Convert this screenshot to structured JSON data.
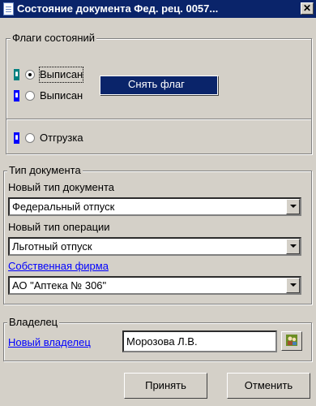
{
  "window": {
    "title": "Состояние документа Фед. рец. 0057...",
    "close_glyph": "✕"
  },
  "flags_group": {
    "legend": "Флаги состояний",
    "items": [
      {
        "label": "Выписан",
        "color": "#008080",
        "checked": true
      },
      {
        "label": "Выписан",
        "color": "#0000ff",
        "checked": false
      }
    ],
    "shipping": {
      "label": "Отгрузка",
      "color": "#0000ff",
      "checked": false
    }
  },
  "context_menu": {
    "item": "Снять флаг"
  },
  "doc_type_group": {
    "legend": "Тип документа",
    "new_doc_type_label": "Новый тип документа",
    "new_doc_type_value": "Федеральный отпуск",
    "new_op_type_label": "Новый тип операции",
    "new_op_type_value": "Льготный отпуск",
    "own_firm_link": "Собственная фирма",
    "own_firm_value": "АО \"Аптека № 306\""
  },
  "owner_group": {
    "legend": "Владелец",
    "new_owner_link": "Новый владелец",
    "owner_value": "Морозова Л.В."
  },
  "buttons": {
    "accept": "Принять",
    "cancel": "Отменить"
  }
}
